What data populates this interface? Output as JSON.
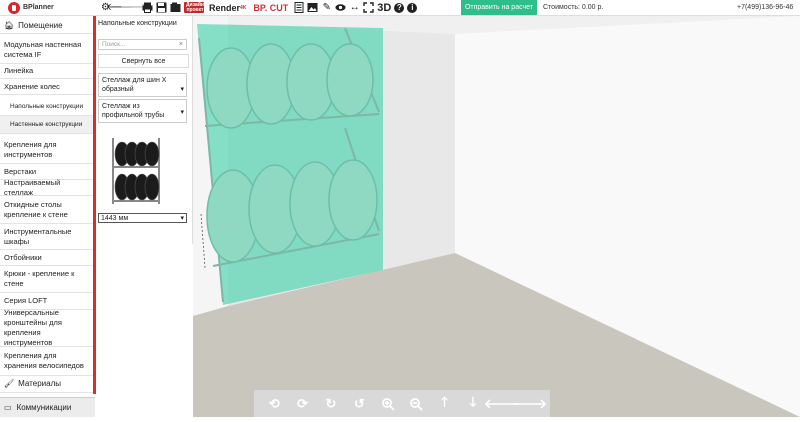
{
  "app": {
    "logo_text": "BPlanner"
  },
  "toolbar": {
    "render_label": "Render",
    "cut_label": "BP. CUT",
    "label_3d": "3D",
    "small_badge": "Дизайн проект",
    "send_button": "Отправить на расчет",
    "cost": "Стоимость: 0.00 р.",
    "phone": "+7(499)136-96-46"
  },
  "sidebar": {
    "room": "Помещение",
    "items": [
      "Модульная настенная система IF",
      "Линейка",
      "Хранение колес",
      "Напольные конструкции",
      "Настенные конструкции",
      "Крепления для инструментов",
      "Верстаки",
      "Настраиваемый стеллаж",
      "Откидные столы крепление к стене",
      "Инструментальные шкафы",
      "Отбойники",
      "Крюки - крепление к стене",
      "Серия LOFT",
      "Универсальные кронштейны для крепления инструментов",
      "Крепления для хранения велосипедов"
    ],
    "materials": "Материалы",
    "communications": "Коммуникации"
  },
  "panel": {
    "title": "Напольные конструкции",
    "search_placeholder": "Поиск...",
    "collapse_all": "Свернуть все",
    "dropdown1": "Стеллаж для шин X образный",
    "dropdown2": "Стеллаж из профильной трубы",
    "size_value": "1443 мм"
  },
  "icons": {
    "toolbar": [
      "gear-icon",
      "undo-icon",
      "redo-icon",
      "print-icon",
      "save-icon",
      "open-icon",
      "image-icon",
      "pencil-icon",
      "eye-icon",
      "resize-icon",
      "fullscreen-icon",
      "help-icon",
      "info-icon"
    ],
    "bottom": [
      "rotate-left-icon",
      "rotate-right-icon",
      "rotate-up-icon",
      "rotate-down-icon",
      "zoom-in-icon",
      "zoom-out-icon",
      "arrow-up-icon",
      "arrow-down-icon",
      "arrow-left-icon",
      "arrow-right-icon"
    ]
  },
  "colors": {
    "accent": "#2ebd8b",
    "red": "#d32f2f",
    "highlight": "#5fd6b5"
  }
}
